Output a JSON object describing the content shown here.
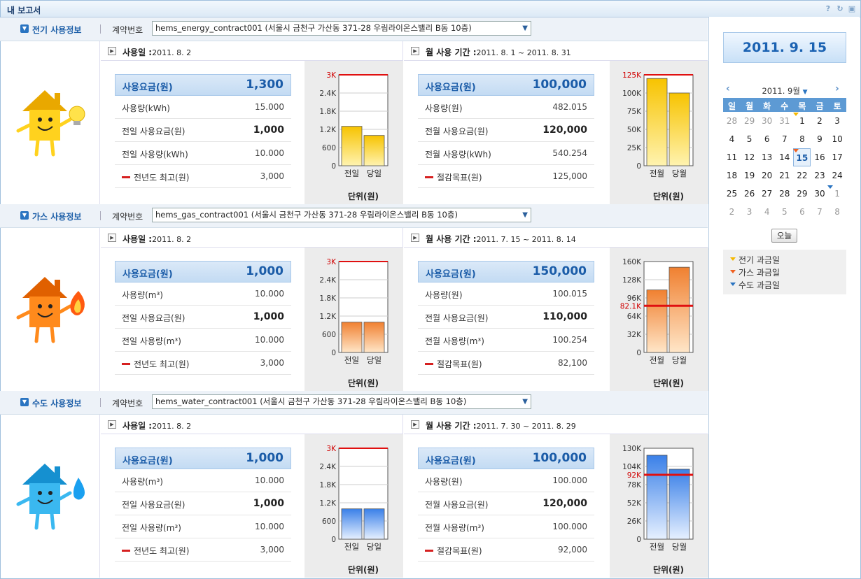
{
  "window": {
    "title": "내 보고서"
  },
  "sections": [
    {
      "key": "elec",
      "title": "전기 사용정보",
      "contract_label": "계약번호",
      "contract": "hems_energy_contract001 (서울시 금천구 가산동 371-28 우림라이온스밸리 B동 10층)",
      "day": {
        "label": "사용일 :",
        "value": "2011. 8. 2",
        "rows": [
          {
            "k": "사용요금(원)",
            "v": "1,300"
          },
          {
            "k": "사용량(kWh)",
            "v": "15.000"
          },
          {
            "k": "전일 사용요금(원)",
            "v": "1,000"
          },
          {
            "k": "전일 사용량(kWh)",
            "v": "10.000"
          },
          {
            "k": "전년도 최고(원)",
            "v": "3,000"
          }
        ]
      },
      "month": {
        "label": "월 사용 기간 :",
        "value": "2011. 8. 1 ~ 2011. 8. 31",
        "rows": [
          {
            "k": "사용요금(원)",
            "v": "100,000"
          },
          {
            "k": "사용량(원)",
            "v": "482.015"
          },
          {
            "k": "전월 사용요금(원)",
            "v": "120,000"
          },
          {
            "k": "전월 사용량(kWh)",
            "v": "540.254"
          },
          {
            "k": "절감목표(원)",
            "v": "125,000"
          }
        ]
      }
    },
    {
      "key": "gas",
      "title": "가스 사용정보",
      "contract_label": "계약번호",
      "contract": "hems_gas_contract001 (서울시 금천구 가산동 371-28 우림라이온스밸리 B동 10층)",
      "day": {
        "label": "사용일 :",
        "value": "2011. 8. 2",
        "rows": [
          {
            "k": "사용요금(원)",
            "v": "1,000"
          },
          {
            "k": "사용량(m³)",
            "v": "10.000"
          },
          {
            "k": "전일 사용요금(원)",
            "v": "1,000"
          },
          {
            "k": "전일 사용량(m³)",
            "v": "10.000"
          },
          {
            "k": "전년도 최고(원)",
            "v": "3,000"
          }
        ]
      },
      "month": {
        "label": "월 사용 기간 :",
        "value": "2011. 7. 15 ~ 2011. 8. 14",
        "rows": [
          {
            "k": "사용요금(원)",
            "v": "150,000"
          },
          {
            "k": "사용량(원)",
            "v": "100.015"
          },
          {
            "k": "전월 사용요금(원)",
            "v": "110,000"
          },
          {
            "k": "전월 사용량(m³)",
            "v": "100.254"
          },
          {
            "k": "절감목표(원)",
            "v": "82,100"
          }
        ]
      }
    },
    {
      "key": "water",
      "title": "수도 사용정보",
      "contract_label": "계약번호",
      "contract": "hems_water_contract001 (서울시 금천구 가산동 371-28 우림라이온스밸리 B동 10층)",
      "day": {
        "label": "사용일 :",
        "value": "2011. 8. 2",
        "rows": [
          {
            "k": "사용요금(원)",
            "v": "1,000"
          },
          {
            "k": "사용량(m³)",
            "v": "10.000"
          },
          {
            "k": "전일 사용요금(원)",
            "v": "1,000"
          },
          {
            "k": "전일 사용량(m³)",
            "v": "10.000"
          },
          {
            "k": "전년도 최고(원)",
            "v": "3,000"
          }
        ]
      },
      "month": {
        "label": "월 사용 기간 :",
        "value": "2011. 7. 30 ~ 2011. 8. 29",
        "rows": [
          {
            "k": "사용요금(원)",
            "v": "100,000"
          },
          {
            "k": "사용량(원)",
            "v": "100.000"
          },
          {
            "k": "전월 사용요금(원)",
            "v": "120,000"
          },
          {
            "k": "전월 사용량(m³)",
            "v": "100.000"
          },
          {
            "k": "절감목표(원)",
            "v": "92,000"
          }
        ]
      }
    }
  ],
  "chart_data": [
    {
      "type": "bar",
      "id": "elec-day",
      "categories": [
        "전일",
        "당일"
      ],
      "values": [
        1300,
        1000
      ],
      "yticks": [
        "0",
        "600",
        "1.2K",
        "1.8K",
        "2.4K",
        "3K"
      ],
      "ylim": [
        0,
        3000
      ],
      "reference": {
        "value": 3000,
        "label": "3K"
      },
      "xlabel": "단위(원)",
      "colors": [
        "#fff3b0",
        "#f7c300"
      ]
    },
    {
      "type": "bar",
      "id": "elec-month",
      "categories": [
        "전월",
        "당월"
      ],
      "values": [
        120000,
        100000
      ],
      "yticks": [
        "0",
        "25K",
        "50K",
        "75K",
        "100K",
        "125K"
      ],
      "ylim": [
        0,
        125000
      ],
      "reference": {
        "value": 125000,
        "label": "125K"
      },
      "xlabel": "단위(원)",
      "colors": [
        "#fff3b0",
        "#f7c300"
      ]
    },
    {
      "type": "bar",
      "id": "gas-day",
      "categories": [
        "전일",
        "당일"
      ],
      "values": [
        1000,
        1000
      ],
      "yticks": [
        "0",
        "600",
        "1.2K",
        "1.8K",
        "2.4K",
        "3K"
      ],
      "ylim": [
        0,
        3000
      ],
      "reference": {
        "value": 3000,
        "label": "3K"
      },
      "xlabel": "단위(원)",
      "colors": [
        "#ffe6c8",
        "#f08030"
      ]
    },
    {
      "type": "bar",
      "id": "gas-month",
      "categories": [
        "전월",
        "당월"
      ],
      "values": [
        110000,
        150000
      ],
      "yticks": [
        "0",
        "32K",
        "64K",
        "96K",
        "128K",
        "160K"
      ],
      "ylim": [
        0,
        160000
      ],
      "reference": {
        "value": 82100,
        "label": "82.1K"
      },
      "xlabel": "단위(원)",
      "colors": [
        "#ffe6c8",
        "#f08030"
      ]
    },
    {
      "type": "bar",
      "id": "water-day",
      "categories": [
        "전일",
        "당일"
      ],
      "values": [
        1000,
        1000
      ],
      "yticks": [
        "0",
        "600",
        "1.2K",
        "1.8K",
        "2.4K",
        "3K"
      ],
      "ylim": [
        0,
        3000
      ],
      "reference": {
        "value": 3000,
        "label": "3K"
      },
      "xlabel": "단위(원)",
      "colors": [
        "#e6f0ff",
        "#3a80e8"
      ]
    },
    {
      "type": "bar",
      "id": "water-month",
      "categories": [
        "전월",
        "당월"
      ],
      "values": [
        120000,
        100000
      ],
      "yticks": [
        "0",
        "26K",
        "52K",
        "78K",
        "104K",
        "130K"
      ],
      "ylim": [
        0,
        130000
      ],
      "reference": {
        "value": 92000,
        "label": "92K"
      },
      "xlabel": "단위(원)",
      "colors": [
        "#e6f0ff",
        "#3a80e8"
      ]
    }
  ],
  "calendar": {
    "date_display": "2011. 9. 15",
    "month_label": "2011. 9월",
    "prev": "‹",
    "next": "›",
    "day_names": [
      "일",
      "월",
      "화",
      "수",
      "목",
      "금",
      "토"
    ],
    "weeks": [
      [
        "28",
        "29",
        "30",
        "31",
        "1",
        "2",
        "3"
      ],
      [
        "4",
        "5",
        "6",
        "7",
        "8",
        "9",
        "10"
      ],
      [
        "11",
        "12",
        "13",
        "14",
        "15",
        "16",
        "17"
      ],
      [
        "18",
        "19",
        "20",
        "21",
        "22",
        "23",
        "24"
      ],
      [
        "25",
        "26",
        "27",
        "28",
        "29",
        "30",
        "1"
      ],
      [
        "2",
        "3",
        "4",
        "5",
        "6",
        "7",
        "8"
      ]
    ],
    "today_label": "오늘",
    "legend": [
      {
        "label": "전기 과금일",
        "color": "#f5b800"
      },
      {
        "label": "가스 과금일",
        "color": "#f06020"
      },
      {
        "label": "수도 과금일",
        "color": "#2a74c1"
      }
    ]
  }
}
